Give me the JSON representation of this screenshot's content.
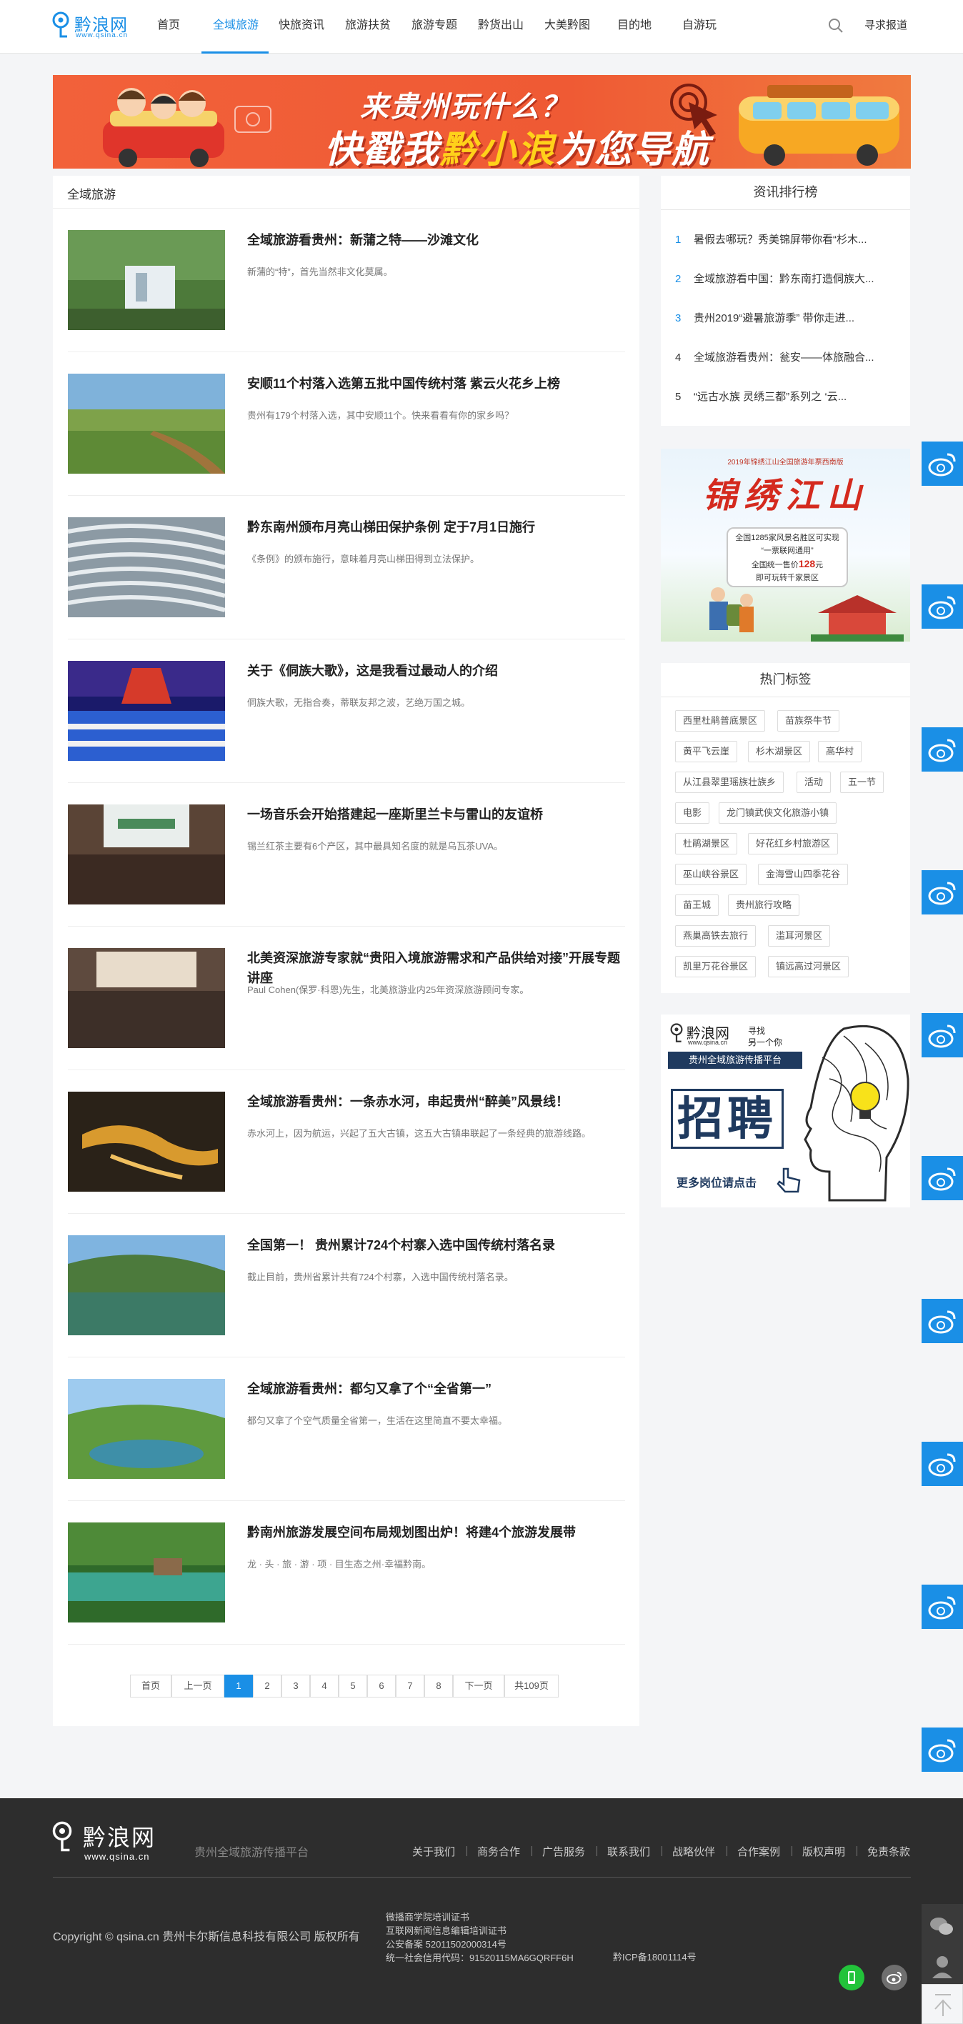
{
  "header": {
    "logo_name": "黔浪网",
    "logo_url": "www.qsina.cn",
    "nav": [
      "首页",
      "全域旅游",
      "快旅资讯",
      "旅游扶贫",
      "旅游专题",
      "黔货出山",
      "大美黔图",
      "目的地",
      "自游玩"
    ],
    "active_nav": "全域旅游",
    "report": "寻求报道"
  },
  "banner": {
    "line1": "来贵州玩什么？",
    "line2_a": "快戳我",
    "line2_b": "黔小浪",
    "line2_c": "为您导航"
  },
  "main": {
    "section_title": "全域旅游",
    "articles": [
      {
        "title": "全域旅游看贵州：新蒲之特——沙滩文化",
        "desc": "新蒲的“特”，首先当然非文化莫属。"
      },
      {
        "title": "安顺11个村落入选第五批中国传统村落 紫云火花乡上榜",
        "desc": "贵州有179个村落入选，其中安顺11个。快来看看有你的家乡吗？"
      },
      {
        "title": "黔东南州颁布月亮山梯田保护条例 定于7月1日施行",
        "desc": "《条例》的颁布施行，意味着月亮山梯田得到立法保护。"
      },
      {
        "title": "关于《侗族大歌》，这是我看过最动人的介绍",
        "desc": "侗族大歌，无指合奏，蒂联友邦之波，艺绝万国之城。"
      },
      {
        "title": "一场音乐会开始搭建起一座斯里兰卡与雷山的友谊桥",
        "desc": "锡兰红茶主要有6个产区，其中最具知名度的就是乌瓦茶UVA。"
      },
      {
        "title": "北美资深旅游专家就“贵阳入境旅游需求和产品供给对接”开展专题讲座",
        "desc": "Paul Cohen(保罗·科恩)先生，北美旅游业内25年资深旅游顾问专家。"
      },
      {
        "title": "全域旅游看贵州：一条赤水河，串起贵州“醉美”风景线！",
        "desc": "赤水河上，因为航运，兴起了五大古镇，这五大古镇串联起了一条经典的旅游线路。"
      },
      {
        "title": "全国第一！ 贵州累计724个村寨入选中国传统村落名录",
        "desc": "截止目前，贵州省累计共有724个村寨，入选中国传统村落名录。"
      },
      {
        "title": "全域旅游看贵州：都匀又拿了个“全省第一”",
        "desc": "都匀又拿了个空气质量全省第一，生活在这里简直不要太幸福。"
      },
      {
        "title": "黔南州旅游发展空间布局规划图出炉！将建4个旅游发展带",
        "desc": "龙 · 头 · 旅 · 游 · 项 · 目生态之州·幸福黔南。"
      }
    ],
    "pager": [
      "首页",
      "上一页",
      "1",
      "2",
      "3",
      "4",
      "5",
      "6",
      "7",
      "8",
      "下一页",
      "共109页"
    ],
    "current_page": "1"
  },
  "sidebar": {
    "rank_title": "资讯排行榜",
    "rank": [
      {
        "num": "1",
        "text": "暑假去哪玩？秀美锦屏带你看“杉木..."
      },
      {
        "num": "2",
        "text": "全域旅游看中国：黔东南打造侗族大..."
      },
      {
        "num": "3",
        "text": "贵州2019“避暑旅游季” 带你走进..."
      },
      {
        "num": "4",
        "text": "全域旅游看贵州：瓮安——体旅融合..."
      },
      {
        "num": "5",
        "text": "“远古水族 灵绣三都”系列之 ‘云..."
      }
    ],
    "ad1": {
      "top": "2019年锦绣江山全国旅游年票西南版",
      "title": "锦绣江山",
      "l1": "全国1285家风景名胜区可实现",
      "l2": "“一票联网通用”",
      "l3a": "全国统一售价",
      "l3b": "128",
      "l3c": "元",
      "l4": "即可玩转千家景区"
    },
    "tags_title": "热门标签",
    "tags": [
      "西里杜鹃普底景区",
      "苗族祭牛节",
      "黄平飞云崖",
      "杉木湖景区",
      "高华村",
      "从江县翠里瑶族壮族乡",
      "活动",
      "五一节",
      "电影",
      "龙门镇武侠文化旅游小镇",
      "杜鹃湖景区",
      "好花红乡村旅游区",
      "巫山峡谷景区",
      "金海雪山四季花谷",
      "苗王城",
      "贵州旅行攻略",
      "燕巢高铁去旅行",
      "滥耳河景区",
      "凯里万花谷景区",
      "镇远高过河景区"
    ],
    "ad2": {
      "name": "黔浪网",
      "url": "www.qsina.cn",
      "slogan1": "寻找",
      "slogan2": "另一个你",
      "platform": "贵州全域旅游传播平台",
      "big": "招聘",
      "more": "更多岗位请点击"
    }
  },
  "footer": {
    "logo_name": "黔浪网",
    "logo_url": "www.qsina.cn",
    "slogan": "贵州全域旅游传播平台",
    "links": [
      "关于我们",
      "商务合作",
      "广告服务",
      "联系我们",
      "战略伙伴",
      "合作案例",
      "版权声明",
      "免责条款"
    ],
    "copyright": "Copyright © qsina.cn 贵州卡尔斯信息科技有限公司 版权所有",
    "licenses": [
      "微播商学院培训证书",
      "互联网新闻信息编辑培训证书",
      "公安备案 52011502000314号",
      "统一社会信用代码：91520115MA6GQRFF6H"
    ],
    "icp": "黔ICP备18001114号"
  },
  "colors": {
    "accent": "#1a8fe6",
    "banner": "#f2613a",
    "footer": "#2d2d2d"
  }
}
